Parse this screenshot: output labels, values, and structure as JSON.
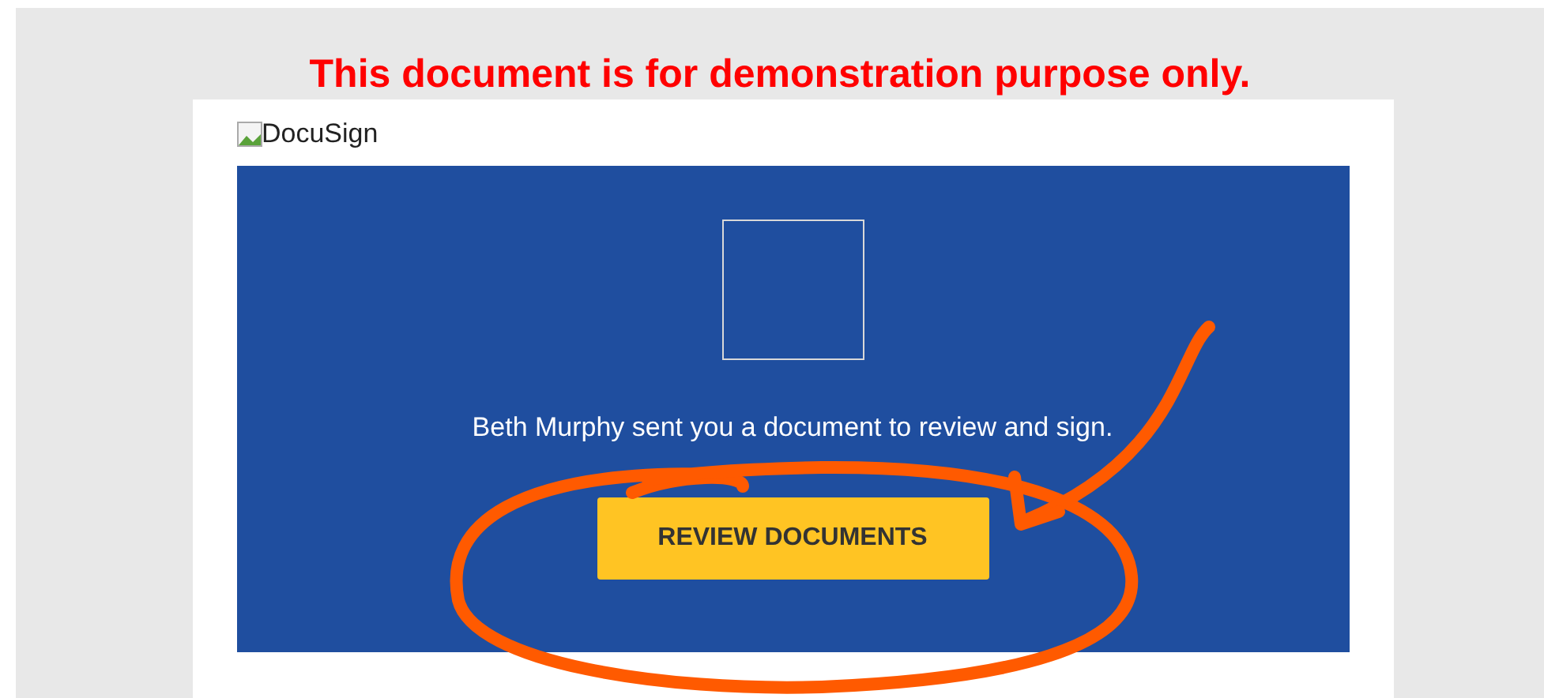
{
  "notice": "This document is for demonstration purpose only.",
  "email": {
    "logo_alt": "DocuSign",
    "message": "Beth Murphy sent you a document to review and sign.",
    "button": "REVIEW DOCUMENTS"
  }
}
